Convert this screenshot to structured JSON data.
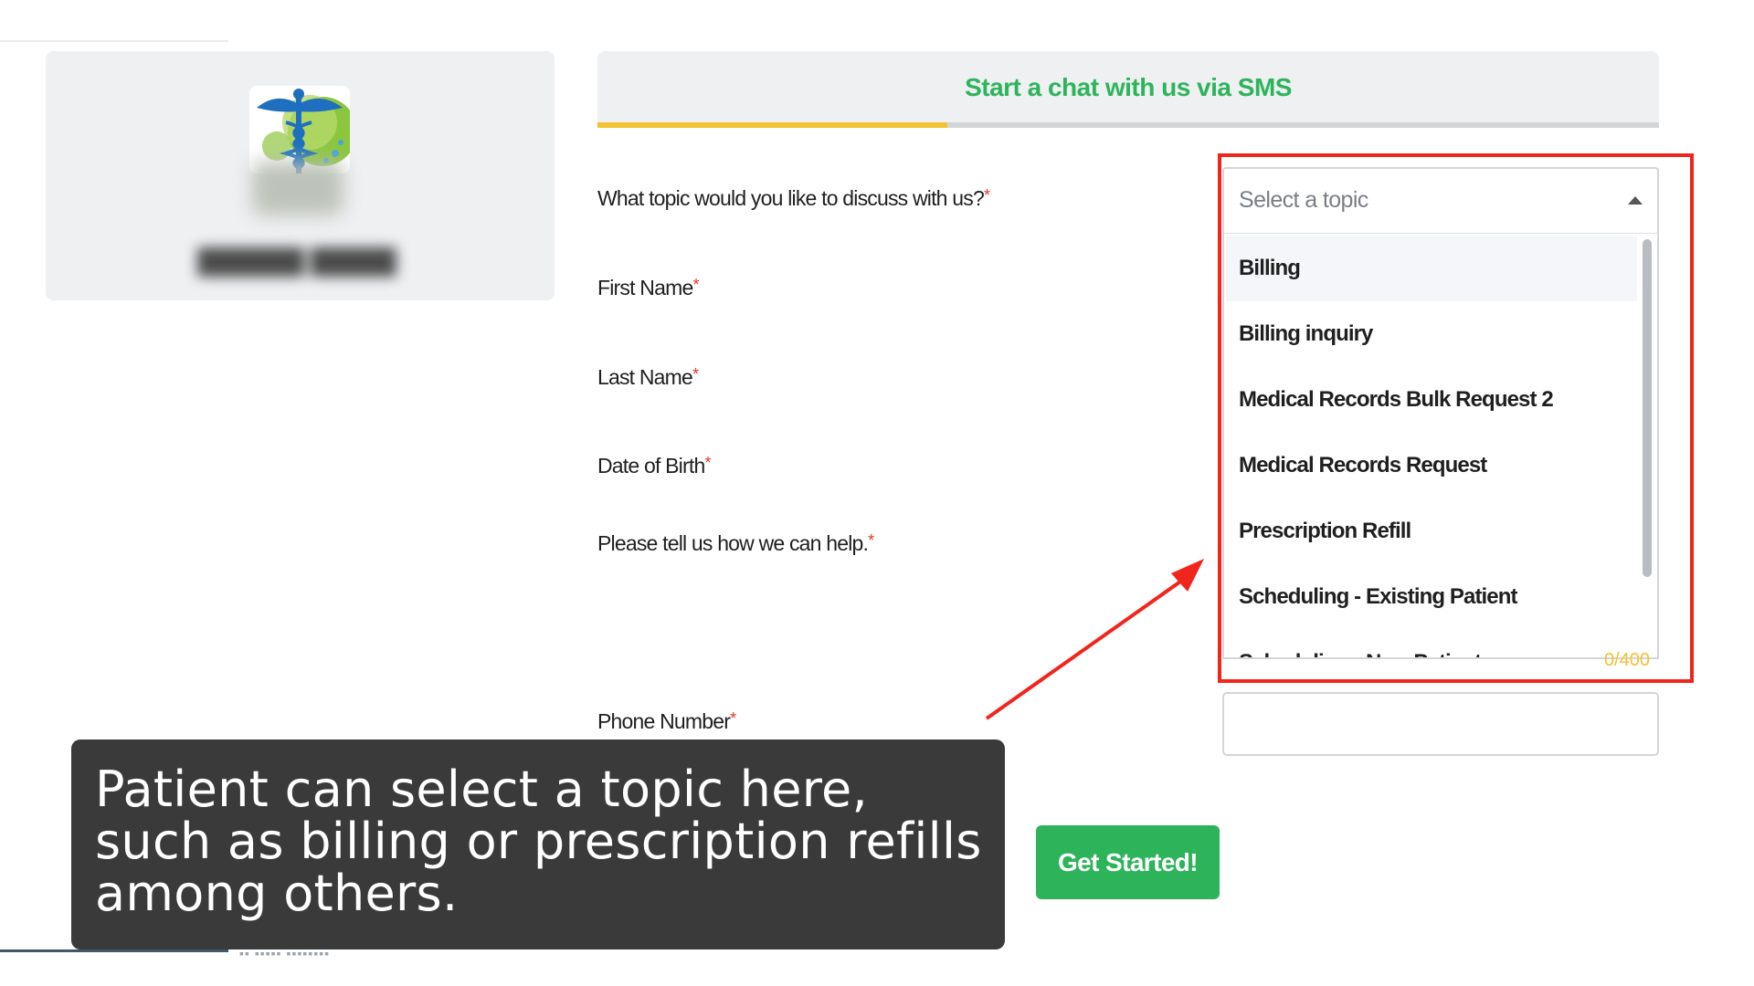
{
  "header": {
    "title": "Start a chat with us via SMS",
    "progress_fraction": 0.33
  },
  "form": {
    "topic_label": "What topic would you like to discuss with us?",
    "first_name_label": "First Name",
    "last_name_label": "Last Name",
    "dob_label": "Date of Birth",
    "help_label": "Please tell us how we can help.",
    "phone_label": "Phone Number",
    "required_mark": "*",
    "topic_select": {
      "placeholder": "Select a topic",
      "options": [
        {
          "label": "Billing"
        },
        {
          "label": "Billing inquiry"
        },
        {
          "label": "Medical Records Bulk Request 2"
        },
        {
          "label": "Medical Records Request"
        },
        {
          "label": "Prescription Refill"
        },
        {
          "label": "Scheduling - Existing Patient"
        },
        {
          "label": "Scheduling - New Patient"
        }
      ]
    },
    "char_counter": "0/400",
    "submit_label": "Get Started!"
  },
  "caption": {
    "text": "Patient can select a topic here, such as billing or prescription refills among others."
  },
  "colors": {
    "brand_green": "#2db45a",
    "progress_yellow": "#f2c230",
    "annotation_red": "#f0261c",
    "caption_bg": "#3a3a3a"
  }
}
